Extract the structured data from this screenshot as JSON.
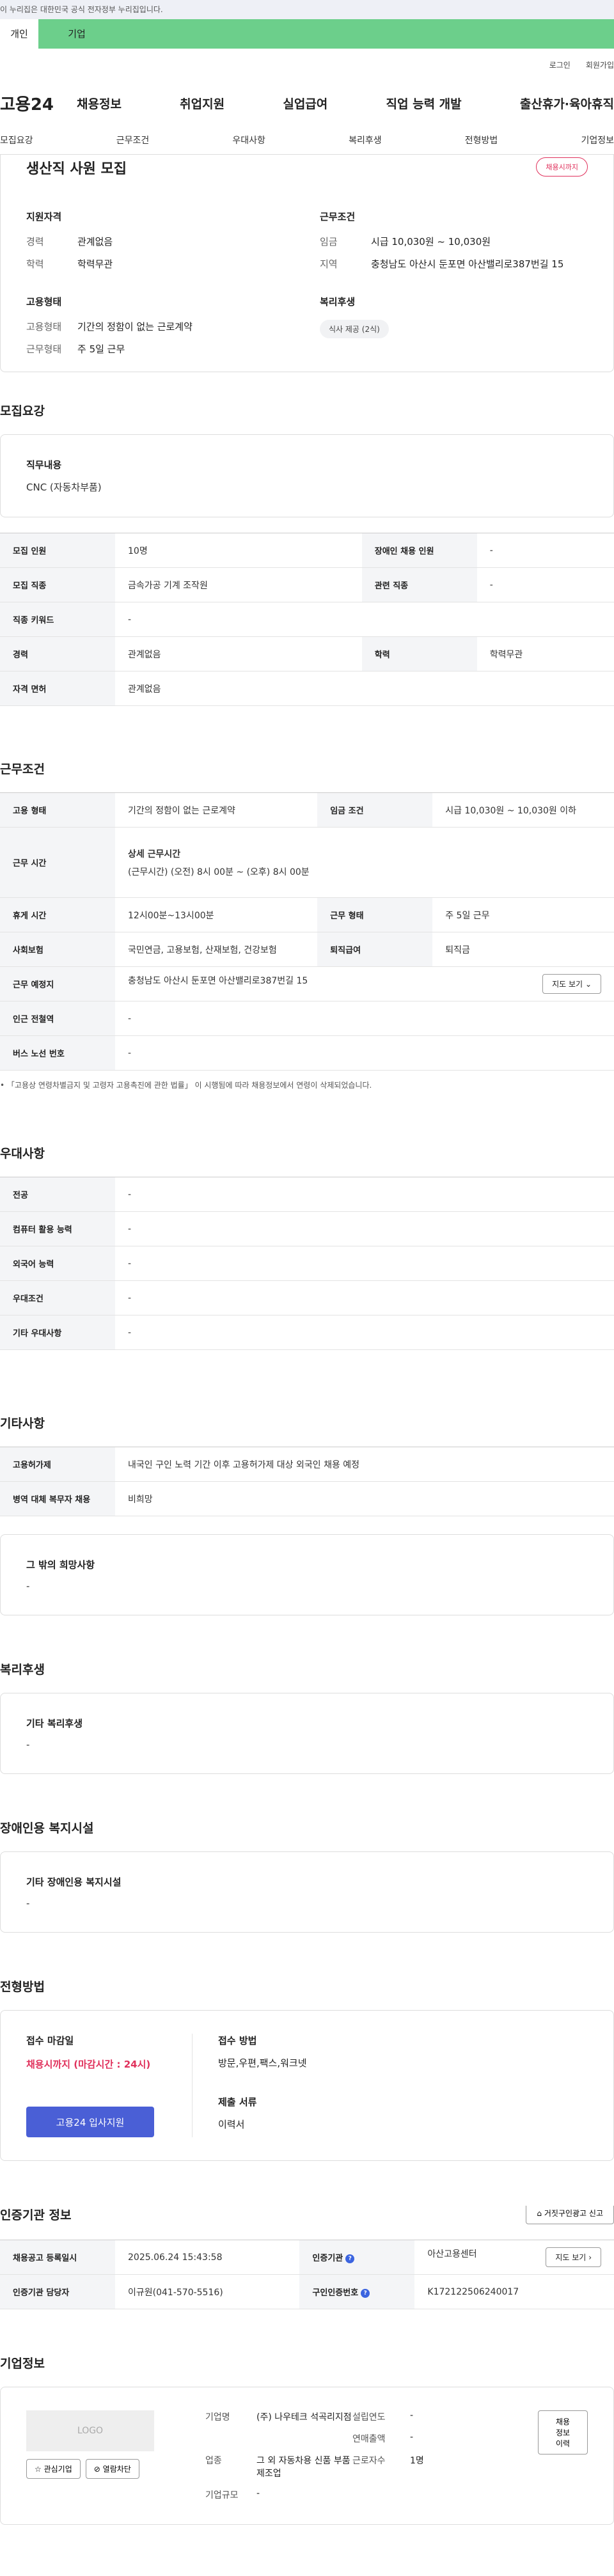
{
  "gov_notice": "이 누리집은 대한민국 공식 전자정부 누리집입니다.",
  "user_tabs": {
    "person": "개인",
    "biz": "기업"
  },
  "util": {
    "login": "로그인",
    "join": "회원가입"
  },
  "logo": "고용24",
  "gnb": [
    "채용정보",
    "취업지원",
    "실업급여",
    "직업 능력 개발",
    "출산휴가·육아휴직"
  ],
  "subnav": [
    "모집요강",
    "근무조건",
    "우대사항",
    "복리후생",
    "전형방법",
    "기업정보"
  ],
  "hero": {
    "title": "생산직 사원 모집",
    "badge": "채용시까지",
    "qual_h": "지원자격",
    "qual": [
      {
        "k": "경력",
        "v": "관계없음"
      },
      {
        "k": "학력",
        "v": "학력무관"
      }
    ],
    "cond_h": "근무조건",
    "cond": [
      {
        "k": "임금",
        "v": "시급 10,030원 ~ 10,030원"
      },
      {
        "k": "지역",
        "v": "충청남도 아산시 둔포면 아산밸리로387번길 15"
      }
    ],
    "emp_h": "고용형태",
    "emp": [
      {
        "k": "고용형태",
        "v": "기간의 정함이 없는 근로계약"
      },
      {
        "k": "근무형태",
        "v": "주 5일 근무"
      }
    ],
    "welfare_h": "복리후생",
    "welfare_chip": "식사 제공 (2식)"
  },
  "recruit": {
    "title": "모집요강",
    "duty_h": "직무내용",
    "duty_v": "CNC (자동차부품)",
    "rows": [
      {
        "k1": "모집 인원",
        "v1": "10명",
        "k2": "장애인 채용 인원",
        "v2": "-"
      },
      {
        "k1": "모집 직종",
        "v1": "금속가공 기계 조작원",
        "k2": "관련 직종",
        "v2": "-"
      },
      {
        "k1": "직종 키워드",
        "v1": "-"
      },
      {
        "k1": "경력",
        "v1": "관계없음",
        "k2": "학력",
        "v2": "학력무관"
      },
      {
        "k1": "자격 면허",
        "v1": "관계없음"
      }
    ]
  },
  "work": {
    "title": "근무조건",
    "type_k": "고용 형태",
    "type_v": "기간의 정함이 없는 근로계약",
    "wage_k": "임금 조건",
    "wage_v": "시급 10,030원 ~ 10,030원 이하",
    "time_k": "근무 시간",
    "time_h": "상세 근무시간",
    "time_v": "(근무시간) (오전) 8시 00분 ~ (오후) 8시 00분",
    "break_k": "휴게 시간",
    "break_v": "12시00분~13시00분",
    "form_k": "근무 형태",
    "form_v": "주 5일 근무",
    "ins_k": "사회보험",
    "ins_v": "국민연금, 고용보험, 산재보험, 건강보험",
    "sev_k": "퇴직급여",
    "sev_v": "퇴직금",
    "place_k": "근무 예정지",
    "place_v": "충청남도 아산시 둔포면 아산밸리로387번길 15",
    "map_btn": "지도 보기",
    "subway_k": "인근 전철역",
    "subway_v": "-",
    "bus_k": "버스 노선 번호",
    "bus_v": "-",
    "note": "「고용상 연령차별금지 및 고령자 고용촉진에 관한 법률」 이 시행됨에 따라 채용정보에서 연령이 삭제되었습니다."
  },
  "pref": {
    "title": "우대사항",
    "rows": [
      {
        "k": "전공",
        "v": "-"
      },
      {
        "k": "컴퓨터 활용 능력",
        "v": "-"
      },
      {
        "k": "외국어 능력",
        "v": "-"
      },
      {
        "k": "우대조건",
        "v": "-"
      },
      {
        "k": "기타 우대사항",
        "v": "-"
      }
    ]
  },
  "etc": {
    "title": "기타사항",
    "rows": [
      {
        "k": "고용허가제",
        "v": "내국인 구인 노력 기간 이후 고용허가제 대상 외국인 채용 예정"
      },
      {
        "k": "병역 대체 복무자 채용",
        "v": "비희망"
      }
    ],
    "other_h": "그 밖의 희망사항",
    "other_v": "-"
  },
  "welfare": {
    "title": "복리후생",
    "h": "기타 복리후생",
    "v": "-"
  },
  "disabled": {
    "title": "장애인용 복지시설",
    "h": "기타 장애인용 복지시설",
    "v": "-"
  },
  "process": {
    "title": "전형방법",
    "deadline_h": "접수 마감일",
    "deadline_v": "채용시까지 (마감시간 : 24시)",
    "apply_btn": "고용24 입사지원",
    "method_h": "접수 방법",
    "method_v": "방문,우편,팩스,워크넷",
    "docs_h": "제출 서류",
    "docs_v": "이력서"
  },
  "cert": {
    "title": "인증기관 정보",
    "report_btn": "거짓구인광고 신고",
    "reg_k": "채용공고 등록일시",
    "reg_v": "2025.06.24 15:43:58",
    "inst_k": "인증기관",
    "inst_v": "아산고용센터",
    "map_btn": "지도 보기",
    "mgr_k": "인증기관 담당자",
    "mgr_v": "이규원(041-570-5516)",
    "no_k": "구인인증번호",
    "no_v": "K172122506240017"
  },
  "company": {
    "title": "기업정보",
    "logo": "LOGO",
    "fav_btn": "관심기업",
    "block_btn": "열람차단",
    "name_k": "기업명",
    "name_v": "(주) 나우테크 석곡리지점",
    "year_k": "설립연도",
    "year_v": "-",
    "sales_k": "연매출액",
    "sales_v": "-",
    "ind_k": "업종",
    "ind_v": "그 외 자동차용 신품 부품 제조업",
    "emp_k": "근로자수",
    "emp_v": "1명",
    "size_k": "기업규모",
    "size_v": "-",
    "history_btn": "채용정보 이력"
  }
}
